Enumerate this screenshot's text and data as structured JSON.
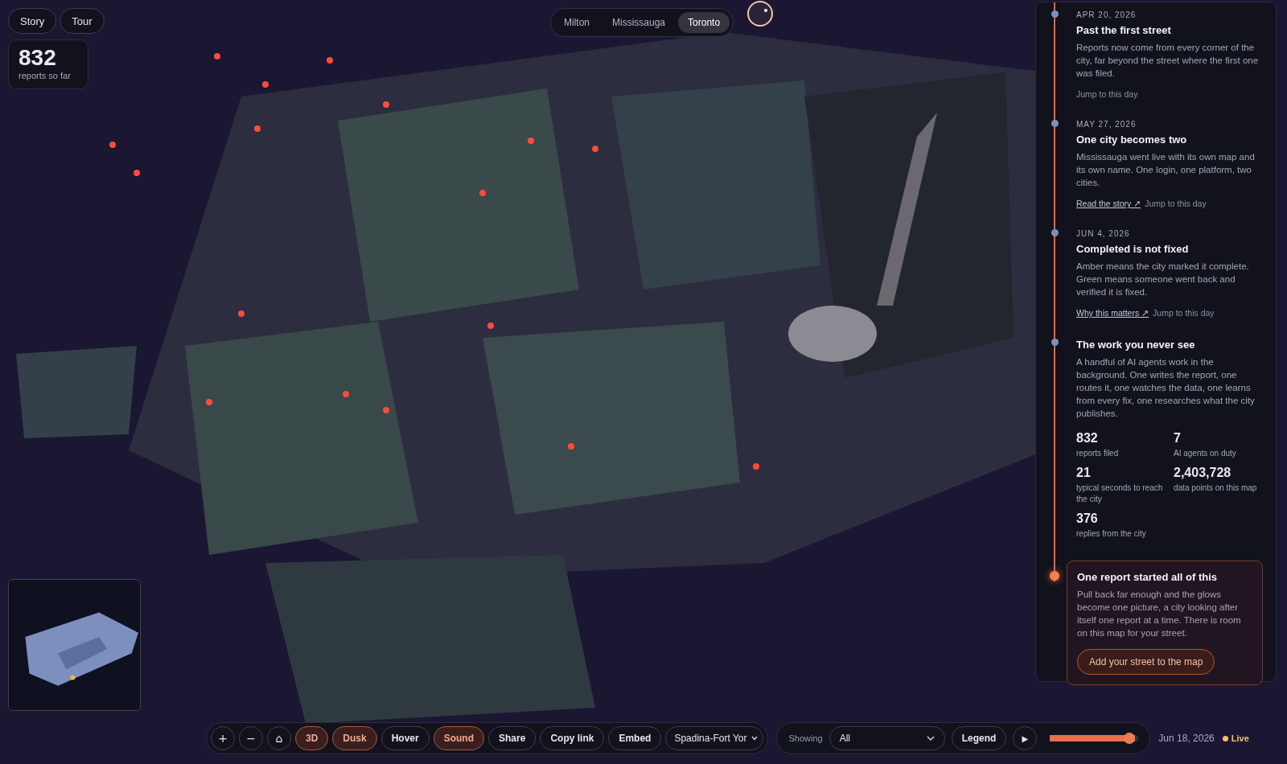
{
  "mode_buttons": [
    {
      "label": "Story"
    },
    {
      "label": "Tour"
    }
  ],
  "counter": {
    "value": "832",
    "label": "reports so far"
  },
  "city_tabs": [
    {
      "label": "Milton",
      "selected": false
    },
    {
      "label": "Mississauga",
      "selected": false
    },
    {
      "label": "Toronto",
      "selected": true
    }
  ],
  "timeline": [
    {
      "date": "APR 20, 2026",
      "title": "Past the first street",
      "body": "Reports now come from every corner of the city, far beyond the street where the first one was filed.",
      "links": [
        {
          "label": "Jump to this day",
          "kind": "jump"
        }
      ],
      "current": false
    },
    {
      "date": "MAY 27, 2026",
      "title": "One city becomes two",
      "body": "Mississauga went live with its own map and its own name. One login, one platform, two cities.",
      "links": [
        {
          "label": "Read the story ↗",
          "kind": "story"
        },
        {
          "label": "Jump to this day",
          "kind": "jump"
        }
      ],
      "current": false
    },
    {
      "date": "JUN 4, 2026",
      "title": "Completed is not fixed",
      "body": "Amber means the city marked it complete. Green means someone went back and verified it is fixed.",
      "links": [
        {
          "label": "Why this matters ↗",
          "kind": "story"
        },
        {
          "label": "Jump to this day",
          "kind": "jump"
        }
      ],
      "current": false
    },
    {
      "title": "The work you never see",
      "body": "A handful of AI agents work in the background. One writes the report, one routes it, one watches the data, one learns from every fix, one researches what the city publishes.",
      "stats": [
        {
          "value": "832",
          "label": "reports filed"
        },
        {
          "value": "7",
          "label": "AI agents on duty"
        },
        {
          "value": "21",
          "label": "typical seconds to reach the city"
        },
        {
          "value": "2,403,728",
          "label": "data points on this map"
        },
        {
          "value": "376",
          "label": "replies from the city"
        }
      ],
      "current": false
    },
    {
      "title": "One report started all of this",
      "body": "Pull back far enough and the glows become one picture, a city looking after itself one report at a time. There is room on this map for your street.",
      "button": "Add your street to the map",
      "current": true
    }
  ],
  "toolbar": [
    {
      "kind": "icon",
      "label": "+"
    },
    {
      "kind": "icon",
      "label": "−"
    },
    {
      "kind": "icon",
      "label": "⌂"
    },
    {
      "kind": "toggle",
      "label": "3D",
      "on": true
    },
    {
      "kind": "toggle",
      "label": "Dusk",
      "on": true
    },
    {
      "kind": "toggle",
      "label": "Hover",
      "on": false
    },
    {
      "kind": "toggle",
      "label": "Sound",
      "on": true
    },
    {
      "kind": "action",
      "label": "Share"
    },
    {
      "kind": "action",
      "label": "Copy link"
    },
    {
      "kind": "action",
      "label": "Embed"
    },
    {
      "kind": "select",
      "label": "Spadina-Fort Yor"
    }
  ],
  "filter": {
    "label": "Showing",
    "value": "All"
  },
  "legend_button": "Legend",
  "play_button": "▶",
  "timeline_slider": {
    "level": 0.96
  },
  "date": "Jun 18, 2026",
  "live": {
    "label": "Live",
    "on": true
  }
}
